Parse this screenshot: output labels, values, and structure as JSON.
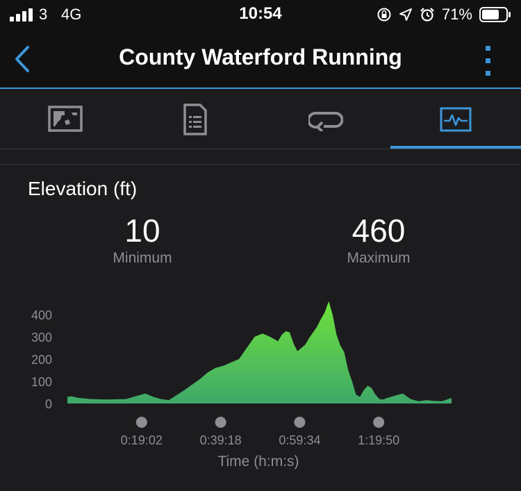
{
  "status_bar": {
    "carrier": "3",
    "network": "4G",
    "time": "10:54",
    "battery": "71%",
    "battery_level": 0.71
  },
  "header": {
    "title": "County Waterford Running",
    "back_icon": "chevron-left-icon",
    "menu_icon": "kebab-menu-icon"
  },
  "tabs": [
    {
      "icon": "map-icon",
      "selected": false
    },
    {
      "icon": "details-document-icon",
      "selected": false
    },
    {
      "icon": "laps-loop-icon",
      "selected": false
    },
    {
      "icon": "chart-activity-icon",
      "selected": true
    }
  ],
  "colors": {
    "accent": "#3b96d9",
    "background": "#1c1c1e",
    "bar": "#111111",
    "area_top": "#6ee23a",
    "area_bottom": "#3fa86a"
  },
  "elevation": {
    "title": "Elevation (ft)",
    "min_value": "10",
    "min_label": "Minimum",
    "max_value": "460",
    "max_label": "Maximum"
  },
  "chart_data": {
    "type": "area",
    "title": "",
    "xlabel": "Time (h:m:s)",
    "ylabel": "",
    "ylim": [
      0,
      460
    ],
    "y_ticks": [
      "400",
      "300",
      "200",
      "100",
      "0"
    ],
    "y_tick_values": [
      400,
      300,
      200,
      100,
      0
    ],
    "x_ticks": [
      "0:19:02",
      "0:39:18",
      "0:59:34",
      "1:19:50"
    ],
    "x_tick_values_min": [
      19.03,
      39.3,
      59.57,
      79.83
    ],
    "x_range_min": [
      0,
      98.5
    ],
    "series": [
      {
        "x": [
          0,
          1,
          3,
          6,
          10,
          15,
          20,
          22,
          24,
          26,
          30,
          34,
          36,
          38,
          40,
          44,
          48,
          50,
          52,
          54,
          55,
          56,
          57,
          58,
          59,
          60,
          61,
          62,
          63,
          64,
          65,
          66,
          67,
          68,
          69,
          70,
          71,
          72,
          73,
          74,
          75,
          76,
          77,
          78,
          79,
          80,
          81,
          82,
          84,
          86,
          88,
          90,
          92,
          94,
          96,
          98.5
        ],
        "y": [
          30,
          32,
          25,
          20,
          18,
          20,
          45,
          30,
          20,
          15,
          60,
          110,
          140,
          160,
          170,
          200,
          300,
          315,
          300,
          280,
          310,
          325,
          320,
          270,
          235,
          250,
          265,
          295,
          320,
          345,
          380,
          410,
          460,
          400,
          310,
          260,
          230,
          150,
          100,
          40,
          30,
          60,
          80,
          70,
          40,
          20,
          18,
          25,
          35,
          45,
          20,
          10,
          15,
          12,
          10,
          25
        ]
      }
    ]
  }
}
